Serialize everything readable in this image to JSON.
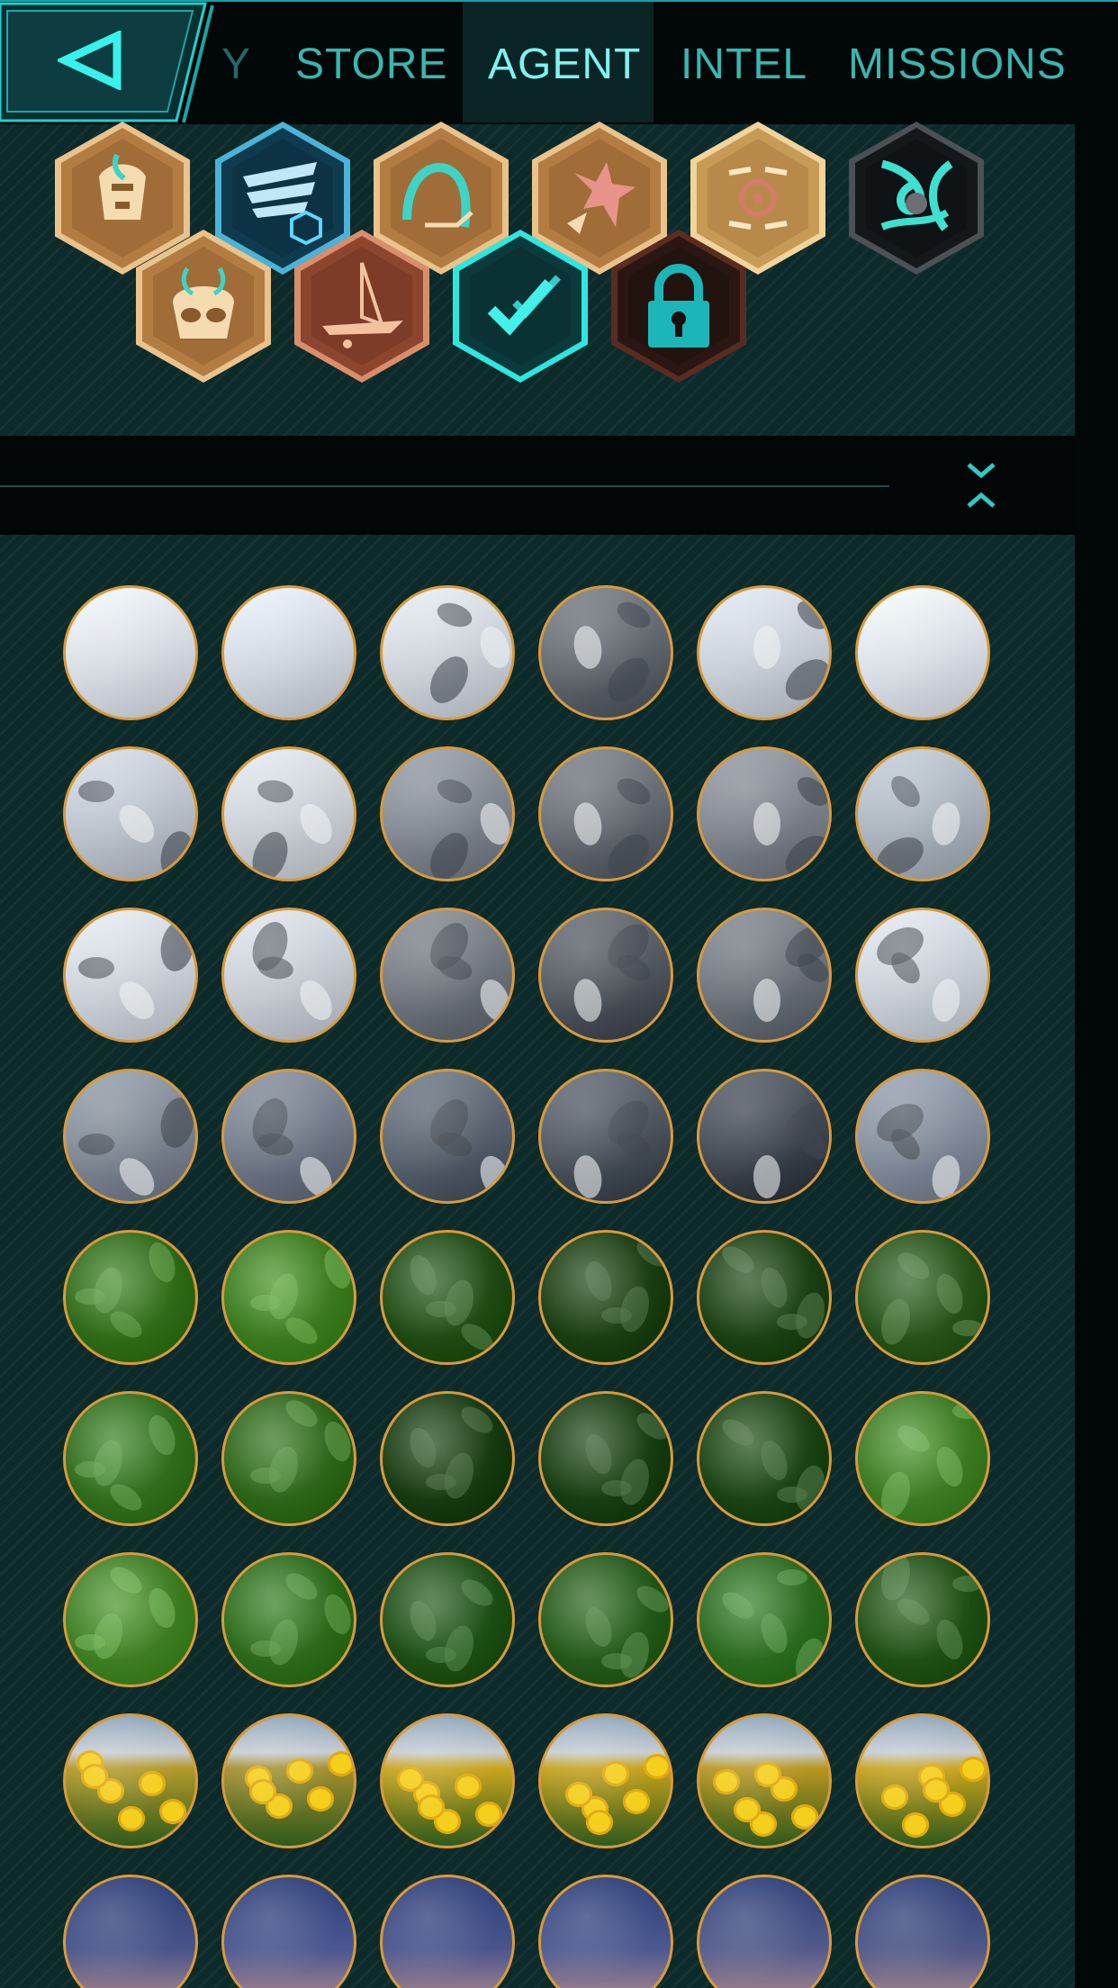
{
  "topbar": {
    "tabs": [
      {
        "label": "Y",
        "name": "tab-partial",
        "active": false,
        "cut": true
      },
      {
        "label": "STORE",
        "name": "tab-store",
        "active": false,
        "cut": false
      },
      {
        "label": "AGENT",
        "name": "tab-agent",
        "active": true,
        "cut": false
      },
      {
        "label": "INTEL",
        "name": "tab-intel",
        "active": false,
        "cut": false
      },
      {
        "label": "MISSIONS",
        "name": "tab-missions",
        "active": false,
        "cut": false
      }
    ],
    "back_icon": "back-triangle-icon"
  },
  "badges": [
    {
      "icon": "bronze-creature-badge-icon",
      "tone": "bronze"
    },
    {
      "icon": "recruit-wings-badge-icon",
      "tone": "blue"
    },
    {
      "icon": "bronze-arch-badge-icon",
      "tone": "bronze"
    },
    {
      "icon": "bronze-shard-badge-icon",
      "tone": "bronze"
    },
    {
      "icon": "gold-cog-badge-icon",
      "tone": "gold"
    },
    {
      "icon": "dark-vortex-badge-icon",
      "tone": "dark"
    },
    {
      "icon": "bronze-mask-badge-icon",
      "tone": "bronze"
    },
    {
      "icon": "copper-glider-badge-icon",
      "tone": "copper"
    },
    {
      "icon": "verified-check-badge-icon",
      "tone": "cyan"
    },
    {
      "icon": "locked-badge-icon",
      "tone": "locked"
    }
  ],
  "section": {
    "collapse_icon": "collapse-chevrons-icon"
  },
  "media_rows": [
    {
      "theme": "overcast-sky",
      "items": [
        "#d4d9e1",
        "#ccd3dc",
        "#c9cfd6",
        "#5e646b",
        "#c4cbd4",
        "#d7dce4"
      ]
    },
    {
      "theme": "snowy-peaks",
      "items": [
        "#b8bfc9",
        "#c7ccd3",
        "#7d848d",
        "#62686f",
        "#7b8089",
        "#a7b0ba"
      ]
    },
    {
      "theme": "glacier",
      "items": [
        "#c9ced6",
        "#c3c8d0",
        "#6d737b",
        "#4f555c",
        "#6a7078",
        "#c6ccd4"
      ]
    },
    {
      "theme": "rocky-mountains",
      "items": [
        "#7b8490",
        "#6d7684",
        "#55606c",
        "#4a525c",
        "#3f4650",
        "#7f8997"
      ]
    },
    {
      "theme": "green-foliage",
      "items": [
        "#2f6a18",
        "#3a7a1e",
        "#1f4a14",
        "#1a3d12",
        "#1b4014",
        "#26521a"
      ]
    },
    {
      "theme": "ferns",
      "items": [
        "#2f6c1c",
        "#2c6418",
        "#173a10",
        "#183d12",
        "#1a4213",
        "#3b7a22"
      ]
    },
    {
      "theme": "fern-closeup",
      "items": [
        "#3d7d22",
        "#2b6a1a",
        "#1d4e16",
        "#24581a",
        "#2a6a1f",
        "#1f4f15"
      ]
    },
    {
      "theme": "daffodils",
      "items": [
        "#b49a2a",
        "#a48f30",
        "#c9a51c",
        "#c6a11a",
        "#b8961e",
        "#c9a31c"
      ]
    },
    {
      "theme": "dusk-sky",
      "items": [
        "#47548a",
        "#4a5790",
        "#4a558d",
        "#4b5990",
        "#525a8c",
        "#4e5788"
      ]
    }
  ]
}
